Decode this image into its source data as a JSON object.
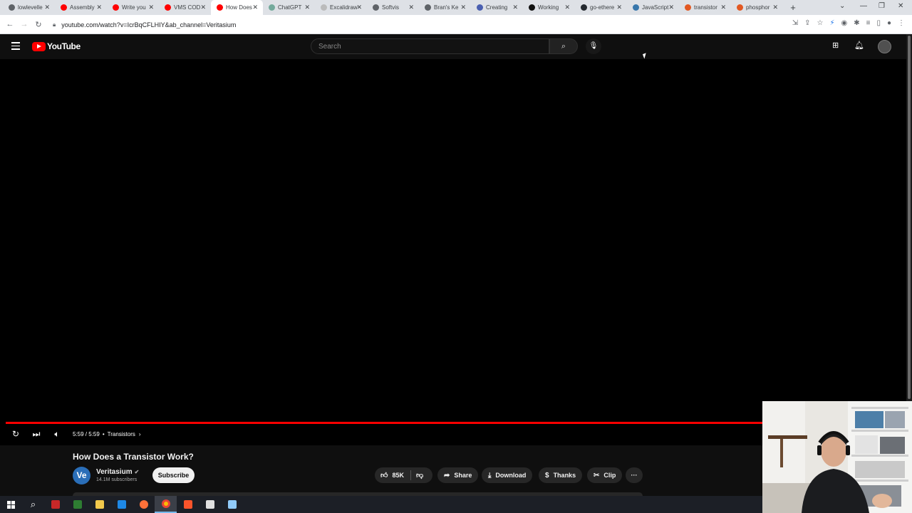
{
  "browser": {
    "tabs": [
      {
        "title": "lowlevelle",
        "favicon_color": "#5f6368"
      },
      {
        "title": "Assembly",
        "favicon_color": "#ff0000"
      },
      {
        "title": "Write you",
        "favicon_color": "#ff0000"
      },
      {
        "title": "VMS COD",
        "favicon_color": "#ff0000"
      },
      {
        "title": "How Does",
        "favicon_color": "#ff0000",
        "active": true
      },
      {
        "title": "ChatGPT",
        "favicon_color": "#74aa9c"
      },
      {
        "title": "Excalidraw",
        "favicon_color": "#bbbbbb"
      },
      {
        "title": "Softvis",
        "favicon_color": "#5f6368"
      },
      {
        "title": "Bran's Ke",
        "favicon_color": "#5f6368"
      },
      {
        "title": "Creating",
        "favicon_color": "#4a5fb0"
      },
      {
        "title": "Working",
        "favicon_color": "#111111"
      },
      {
        "title": "go-ethere",
        "favicon_color": "#24292f"
      },
      {
        "title": "JavaScript",
        "favicon_color": "#3776ab"
      },
      {
        "title": "transistor",
        "favicon_color": "#e25822"
      },
      {
        "title": "phosphor",
        "favicon_color": "#e25822"
      }
    ],
    "new_tab": "+",
    "url": "youtube.com/watch?v=IcrBqCFLHIY&ab_channel=Veritasium"
  },
  "masthead": {
    "logo_text": "YouTube",
    "search_placeholder": "Search"
  },
  "player": {
    "time": "5:59 / 5:59",
    "separator": "•",
    "chapter": "Transistors",
    "progress": 1.0,
    "progress_color": "#ff0000"
  },
  "video": {
    "title": "How Does a Transistor Work?",
    "channel": {
      "avatar_text": "Ve",
      "name": "Veritasium",
      "subscribers": "14.1M subscribers"
    },
    "subscribe_label": "Subscribe",
    "actions": {
      "likes": "85K",
      "share": "Share",
      "download": "Download",
      "thanks": "Thanks",
      "clip": "Clip",
      "more": "···"
    }
  },
  "colors": {
    "youtube_red": "#ff0000",
    "background": "#0f0f0f",
    "pill": "#272727"
  }
}
